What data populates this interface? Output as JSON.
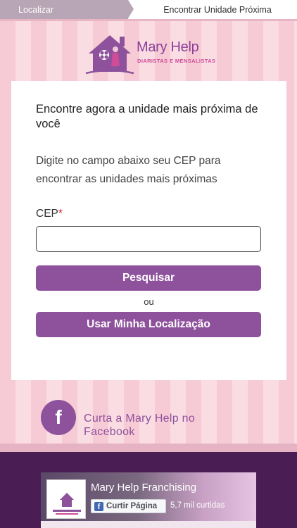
{
  "breadcrumb": {
    "previous": "Localizar",
    "current": "Encontrar Unidade Próxima"
  },
  "logo": {
    "title": "Mary Help",
    "subtitle": "DIARISTAS E MENSALISTAS"
  },
  "card": {
    "heading": "Encontre agora a unidade mais próxima de você",
    "description": "Digite no campo abaixo seu CEP para encontrar as unidades mais próximas",
    "cep_label": "CEP",
    "required_mark": "*",
    "cep_value": "",
    "search_label": "Pesquisar",
    "or_label": "ou",
    "location_label": "Usar Minha Localização"
  },
  "facebook": {
    "link_text": "Curta a Mary Help no Facebook",
    "page_name": "Mary Help Franchising",
    "like_label": "Curtir Página",
    "likes": "5,7 mil curtidas"
  },
  "colors": {
    "brand_purple": "#8e519c",
    "footer": "#4b1d55",
    "accent_pink": "#d04b98",
    "required_red": "#d21c2b"
  },
  "icons": [
    "house-logo-icon",
    "facebook-icon",
    "facebook-small-icon"
  ]
}
